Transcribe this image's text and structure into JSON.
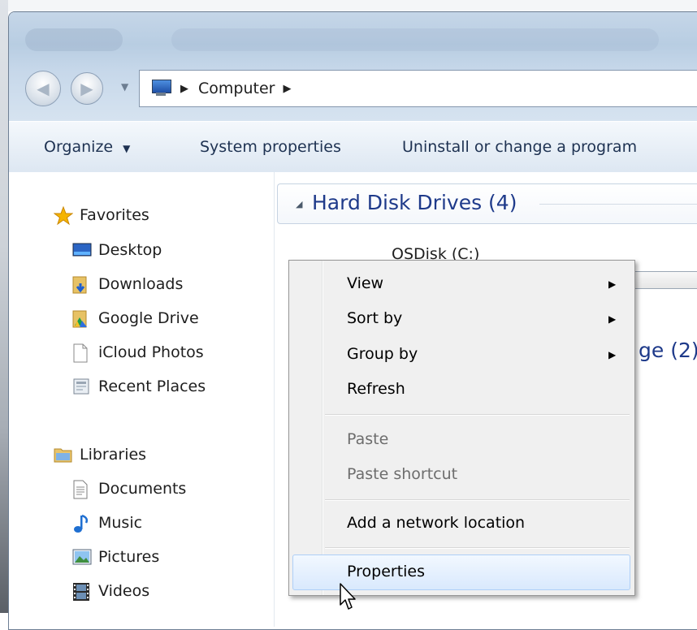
{
  "address_bar": {
    "crumbs": [
      "Computer"
    ],
    "computer_icon": "computer-icon"
  },
  "toolbar": {
    "organize": "Organize",
    "system_properties": "System properties",
    "uninstall": "Uninstall or change a program"
  },
  "nav": {
    "favorites": {
      "label": "Favorites",
      "items": [
        {
          "label": "Desktop",
          "icon": "desktop-icon"
        },
        {
          "label": "Downloads",
          "icon": "downloads-folder-icon"
        },
        {
          "label": "Google Drive",
          "icon": "google-drive-folder-icon"
        },
        {
          "label": "iCloud Photos",
          "icon": "blank-file-icon"
        },
        {
          "label": "Recent Places",
          "icon": "recent-places-icon"
        }
      ]
    },
    "libraries": {
      "label": "Libraries",
      "items": [
        {
          "label": "Documents",
          "icon": "documents-icon"
        },
        {
          "label": "Music",
          "icon": "music-note-icon"
        },
        {
          "label": "Pictures",
          "icon": "pictures-icon"
        },
        {
          "label": "Videos",
          "icon": "film-icon"
        }
      ]
    }
  },
  "content": {
    "group_title": "Hard Disk Drives (4)",
    "drive_label": "OSDisk (C:)",
    "partial_group": "ge (2)"
  },
  "context_menu": {
    "items": [
      {
        "label": "View",
        "submenu": true,
        "enabled": true
      },
      {
        "label": "Sort by",
        "submenu": true,
        "enabled": true
      },
      {
        "label": "Group by",
        "submenu": true,
        "enabled": true
      },
      {
        "label": "Refresh",
        "submenu": false,
        "enabled": true
      },
      {
        "label": "Paste",
        "submenu": false,
        "enabled": false
      },
      {
        "label": "Paste shortcut",
        "submenu": false,
        "enabled": false
      },
      {
        "label": "Add a network location",
        "submenu": false,
        "enabled": true
      },
      {
        "label": "Properties",
        "submenu": false,
        "enabled": true,
        "highlighted": true
      }
    ]
  },
  "colors": {
    "accent_header": "#1e3a8a",
    "hover_border": "#aecff7",
    "disabled_text": "#6d6d6d"
  }
}
